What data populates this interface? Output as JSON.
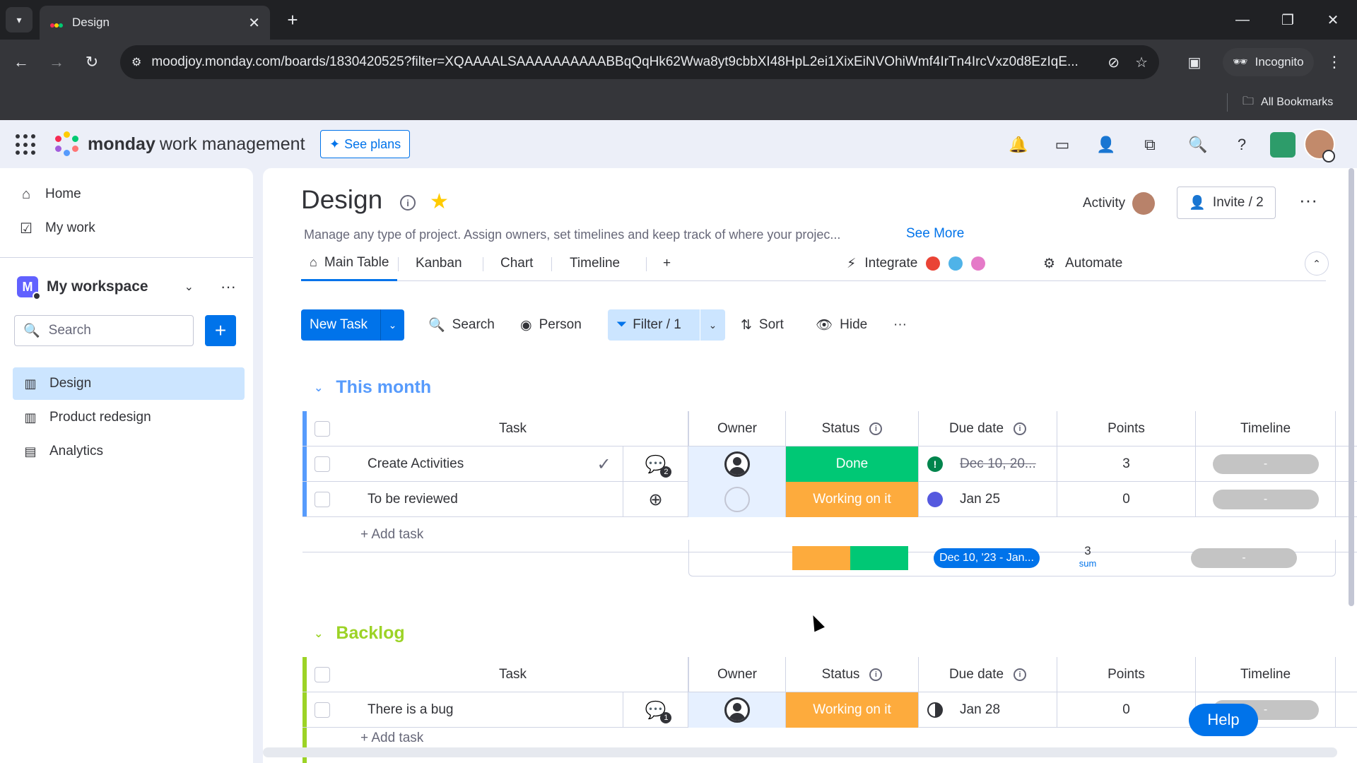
{
  "browser": {
    "tab_title": "Design",
    "tab_close": "✕",
    "new_tab": "+",
    "url": "moodjoy.monday.com/boards/1830420525?filter=XQAAAALSAAAAAAAAAABBqQqHk62Wwa8yt9cbbXI48HpL2ei1XixEiNVOhiWmf4IrTn4IrcVxz0d8EzIqE...",
    "incognito_label": "Incognito",
    "all_bookmarks": "All Bookmarks"
  },
  "topnav": {
    "brand": "monday",
    "brand_sub": "work management",
    "see_plans": "See plans"
  },
  "sidebar": {
    "home": "Home",
    "my_work": "My work",
    "workspace_initial": "M",
    "workspace_name": "My workspace",
    "search_placeholder": "Search",
    "boards": [
      {
        "label": "Design"
      },
      {
        "label": "Product redesign"
      },
      {
        "label": "Analytics"
      }
    ]
  },
  "board": {
    "title": "Design",
    "description": "Manage any type of project. Assign owners, set timelines and keep track of where your projec...",
    "see_more": "See More",
    "activity": "Activity",
    "invite": "Invite / 2",
    "views": [
      "Main Table",
      "Kanban",
      "Chart",
      "Timeline",
      "+"
    ],
    "integrate": "Integrate",
    "automate": "Automate"
  },
  "toolbar": {
    "new_task": "New Task",
    "search": "Search",
    "person": "Person",
    "filter": "Filter / 1",
    "sort": "Sort",
    "hide": "Hide",
    "more": "···"
  },
  "columns": {
    "task": "Task",
    "owner": "Owner",
    "status": "Status",
    "due_date": "Due date",
    "points": "Points",
    "timeline": "Timeline"
  },
  "groups": [
    {
      "name": "This month",
      "color": "#579bfc",
      "rows": [
        {
          "task": "Create Activities",
          "updates": "2",
          "status": "Done",
          "status_color": "#00c875",
          "due": "Dec 10, 20...",
          "points": "3",
          "timeline": "-"
        },
        {
          "task": "To be reviewed",
          "status": "Working on it",
          "status_color": "#fdab3d",
          "due": "Jan 25",
          "points": "0",
          "timeline": "-"
        }
      ],
      "add_task": "+ Add task",
      "summary": {
        "date_range": "Dec 10, '23 - Jan...",
        "points": "3",
        "points_label": "sum",
        "timeline": "-",
        "status_split": [
          0.5,
          0.5
        ]
      }
    },
    {
      "name": "Backlog",
      "color": "#9cd326",
      "rows": [
        {
          "task": "There is a bug",
          "updates": "1",
          "status": "Working on it",
          "status_color": "#fdab3d",
          "due": "Jan 28",
          "points": "0",
          "timeline": "-"
        }
      ],
      "add_task": "+ Add task"
    }
  ],
  "help": "Help",
  "colors": {
    "primary": "#0073ea",
    "done": "#00c875",
    "working": "#fdab3d"
  }
}
